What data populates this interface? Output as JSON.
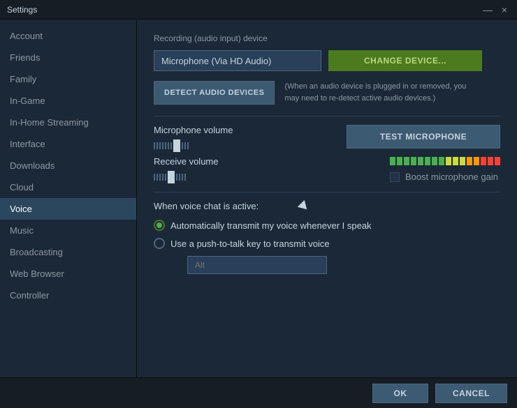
{
  "titlebar": {
    "title": "Settings",
    "close": "×",
    "minimize": "—"
  },
  "sidebar": {
    "items": [
      {
        "label": "Account",
        "active": false
      },
      {
        "label": "Friends",
        "active": false
      },
      {
        "label": "Family",
        "active": false
      },
      {
        "label": "In-Game",
        "active": false
      },
      {
        "label": "In-Home Streaming",
        "active": false
      },
      {
        "label": "Interface",
        "active": false
      },
      {
        "label": "Downloads",
        "active": false
      },
      {
        "label": "Cloud",
        "active": false
      },
      {
        "label": "Voice",
        "active": true
      },
      {
        "label": "Music",
        "active": false
      },
      {
        "label": "Broadcasting",
        "active": false
      },
      {
        "label": "Web Browser",
        "active": false
      },
      {
        "label": "Controller",
        "active": false
      }
    ]
  },
  "content": {
    "recording_label": "Recording (audio input) device",
    "device_value": "Microphone (Via HD Audio)",
    "change_device_btn": "CHANGE DEVICE...",
    "detect_btn": "DETECT AUDIO DEVICES",
    "detect_note": "(When an audio device is plugged in or removed, you may need to re-detect active audio devices.)",
    "microphone_volume_label": "Microphone volume",
    "test_microphone_btn": "TEST MICROPHONE",
    "receive_volume_label": "Receive volume",
    "boost_label": "Boost microphone gain",
    "voice_active_label": "When voice chat is active:",
    "radio_auto_label": "Automatically transmit my voice whenever I speak",
    "radio_ptt_label": "Use a push-to-talk key to transmit voice",
    "ptt_placeholder": "Alt"
  },
  "footer": {
    "ok_btn": "OK",
    "cancel_btn": "CANCEL"
  }
}
